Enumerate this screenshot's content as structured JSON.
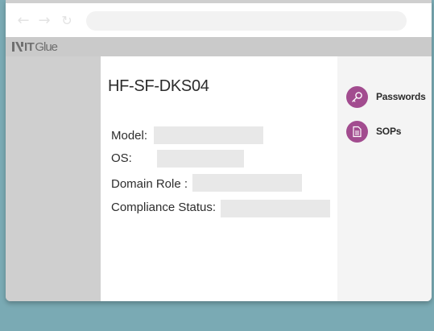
{
  "browser": {
    "back_icon": "arrow-left",
    "forward_icon": "arrow-right",
    "reload_icon": "reload"
  },
  "app": {
    "logo_text_bold": "IT",
    "logo_text_light": "Glue"
  },
  "device": {
    "title": "HF-SF-DKS04",
    "fields": [
      {
        "label": "Model:",
        "value": ""
      },
      {
        "label": "OS:",
        "value": ""
      },
      {
        "label": "Domain Role :",
        "value": ""
      },
      {
        "label": "Compliance Status:",
        "value": ""
      }
    ]
  },
  "sidebar": {
    "links": [
      {
        "label": "Passwords",
        "icon": "key-icon"
      },
      {
        "label": "SOPs",
        "icon": "document-icon"
      }
    ]
  },
  "colors": {
    "accent": "#a24c8f",
    "background": "#7aaab4"
  }
}
